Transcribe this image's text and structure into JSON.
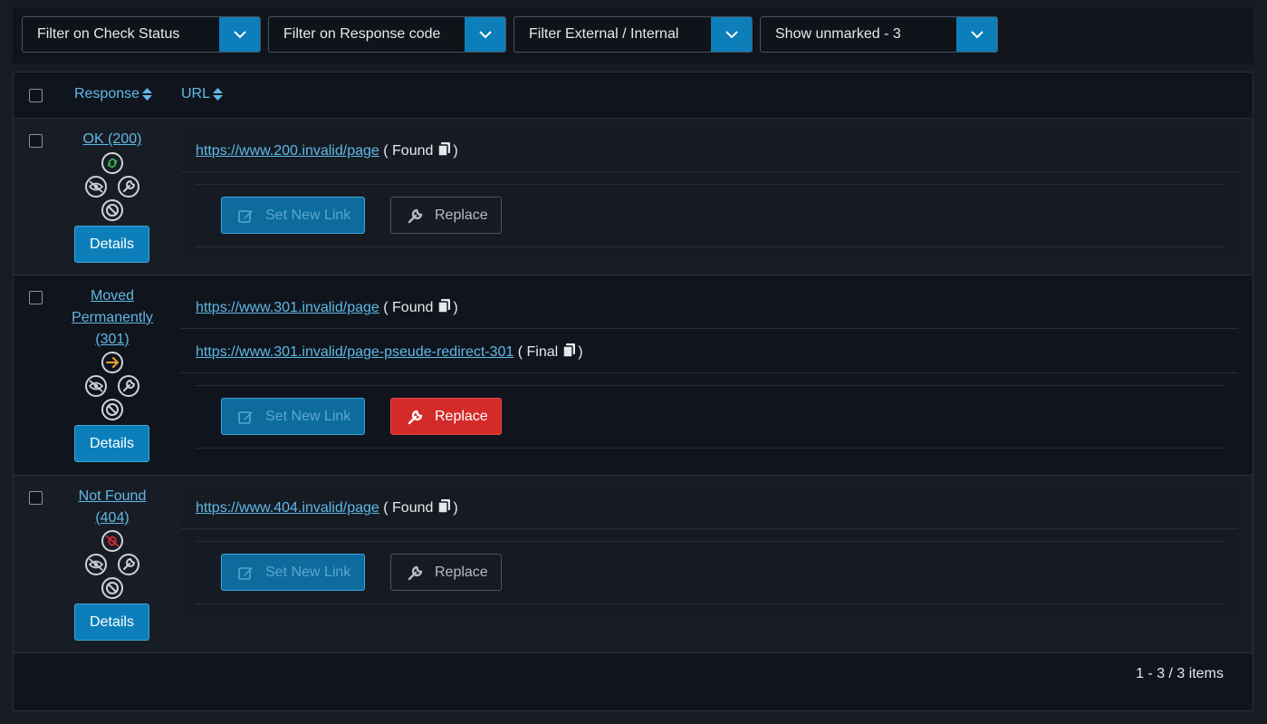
{
  "filters": [
    {
      "label": "Filter on Check Status"
    },
    {
      "label": "Filter on Response code"
    },
    {
      "label": "Filter External / Internal"
    },
    {
      "label": "Show unmarked - 3"
    }
  ],
  "table": {
    "headers": {
      "response": "Response",
      "url": "URL"
    },
    "rows": [
      {
        "response_label": "OK (200)",
        "urls": [
          {
            "href": "https://www.200.invalid/page",
            "status": "Found"
          }
        ],
        "details_label": "Details",
        "set_new_link_label": "Set New Link",
        "replace_label": "Replace",
        "replace_active": false
      },
      {
        "response_label": "Moved Permanently (301)",
        "response_lines": [
          "Moved",
          "Permanently",
          "(301)"
        ],
        "urls": [
          {
            "href": "https://www.301.invalid/page",
            "status": "Found"
          },
          {
            "href": "https://www.301.invalid/page-pseude-redirect-301",
            "status": "Final"
          }
        ],
        "details_label": "Details",
        "set_new_link_label": "Set New Link",
        "replace_label": "Replace",
        "replace_active": true
      },
      {
        "response_label": "Not Found (404)",
        "response_lines": [
          "Not Found",
          "(404)"
        ],
        "urls": [
          {
            "href": "https://www.404.invalid/page",
            "status": "Found"
          }
        ],
        "details_label": "Details",
        "set_new_link_label": "Set New Link",
        "replace_label": "Replace",
        "replace_active": false
      }
    ]
  },
  "pager": {
    "summary": "1 - 3 / 3 items"
  },
  "colors": {
    "accent": "#0c7fba",
    "link": "#5fb8e6",
    "danger": "#d42a2a",
    "ok": "#3fae5a",
    "warn": "#f0a030"
  },
  "icons": [
    "chevron-down-icon",
    "sort-icon",
    "link-ok-icon",
    "redirect-icon",
    "broken-link-icon",
    "eye-slash-icon",
    "wrench-icon",
    "ban-icon",
    "edit-icon",
    "copy-icon"
  ]
}
